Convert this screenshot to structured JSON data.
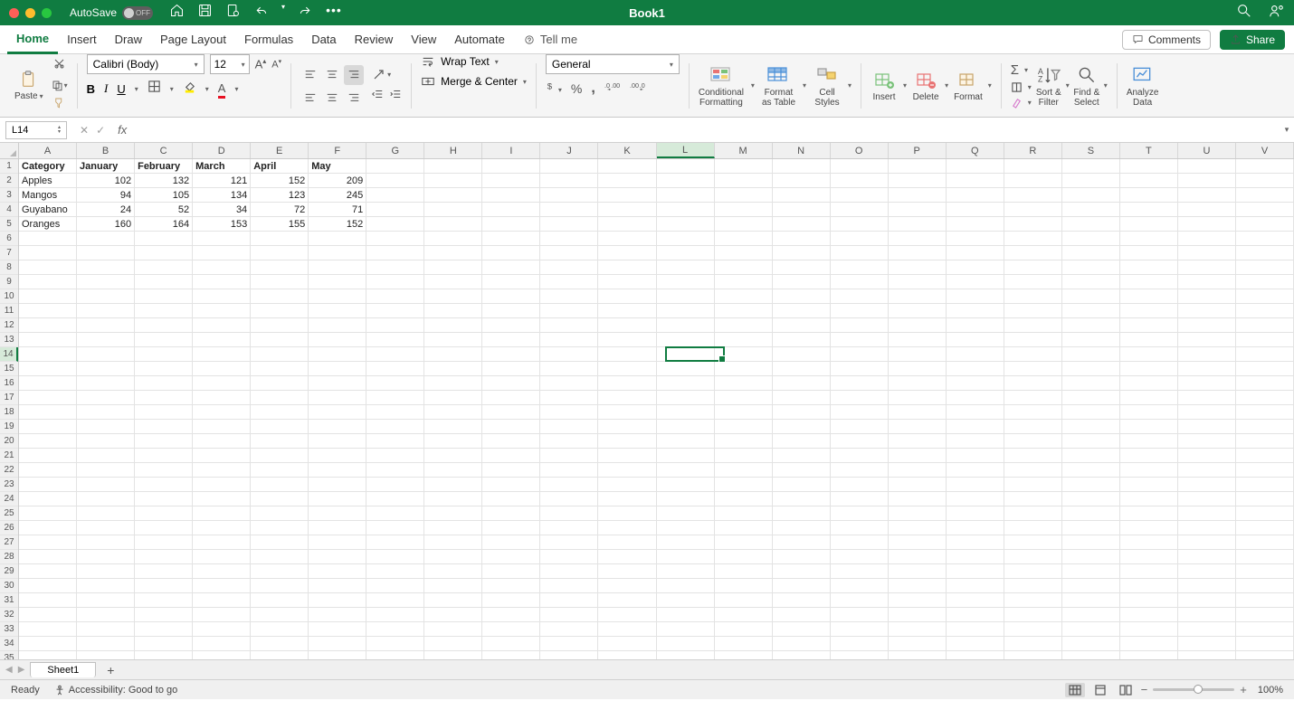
{
  "titlebar": {
    "autosave_label": "AutoSave",
    "autosave_state": "OFF",
    "title": "Book1"
  },
  "tabs": [
    "Home",
    "Insert",
    "Draw",
    "Page Layout",
    "Formulas",
    "Data",
    "Review",
    "View",
    "Automate"
  ],
  "active_tab": "Home",
  "tellme": "Tell me",
  "comments_label": "Comments",
  "share_label": "Share",
  "ribbon": {
    "paste": "Paste",
    "font": "Calibri (Body)",
    "size": "12",
    "wrap": "Wrap Text",
    "merge": "Merge & Center",
    "numfmt": "General",
    "cond": "Conditional\nFormatting",
    "fmt_table": "Format\nas Table",
    "cell_styles": "Cell\nStyles",
    "insert": "Insert",
    "delete": "Delete",
    "format": "Format",
    "sort": "Sort &\nFilter",
    "find": "Find &\nSelect",
    "analyze": "Analyze\nData"
  },
  "namebox": "L14",
  "columns": [
    "A",
    "B",
    "C",
    "D",
    "E",
    "F",
    "G",
    "H",
    "I",
    "J",
    "K",
    "L",
    "M",
    "N",
    "O",
    "P",
    "Q",
    "R",
    "S",
    "T",
    "U",
    "V"
  ],
  "active_col": "L",
  "active_row": 14,
  "rows_visible": 35,
  "cells": {
    "headers": [
      "Category",
      "January",
      "February",
      "March",
      "April",
      "May"
    ],
    "data": [
      [
        "Apples",
        102,
        132,
        121,
        152,
        209
      ],
      [
        "Mangos",
        94,
        105,
        134,
        123,
        245
      ],
      [
        "Guyabano",
        24,
        52,
        34,
        72,
        71
      ],
      [
        "Oranges",
        160,
        164,
        153,
        155,
        152
      ]
    ]
  },
  "sheet_tab": "Sheet1",
  "status": {
    "ready": "Ready",
    "accessibility": "Accessibility: Good to go",
    "zoom": "100%"
  }
}
